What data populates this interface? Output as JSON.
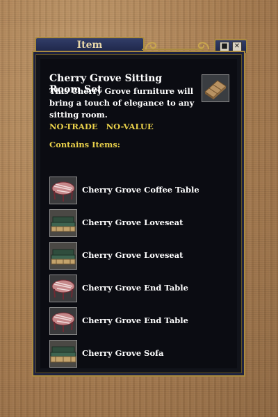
{
  "window": {
    "title": "Item",
    "buttons": [
      {
        "icon": "minimize-icon",
        "glyph": "■"
      },
      {
        "icon": "close-icon",
        "glyph": "✕"
      }
    ]
  },
  "item": {
    "name": "Cherry Grove Sitting Room Set",
    "description": "This Cherry Grove furniture will bring a touch of elegance to any sitting room.",
    "flags": [
      "NO-TRADE",
      "NO-VALUE"
    ],
    "icon": "crate-icon",
    "contains_label": "Contains Items:",
    "contents": [
      {
        "name": "Cherry Grove Coffee Table",
        "icon": "round-table-icon"
      },
      {
        "name": "Cherry Grove Loveseat",
        "icon": "loveseat-icon"
      },
      {
        "name": "Cherry Grove Loveseat",
        "icon": "loveseat-icon"
      },
      {
        "name": "Cherry Grove End Table",
        "icon": "round-table-icon"
      },
      {
        "name": "Cherry Grove End Table",
        "icon": "round-table-icon"
      },
      {
        "name": "Cherry Grove Sofa",
        "icon": "sofa-icon"
      }
    ]
  },
  "colors": {
    "frame_gold": "#a98a3f",
    "title_blue": "#1e2649",
    "panel_bg": "#0b0c12",
    "flag_yellow": "#e9d04a",
    "text_white": "#ffffff"
  }
}
